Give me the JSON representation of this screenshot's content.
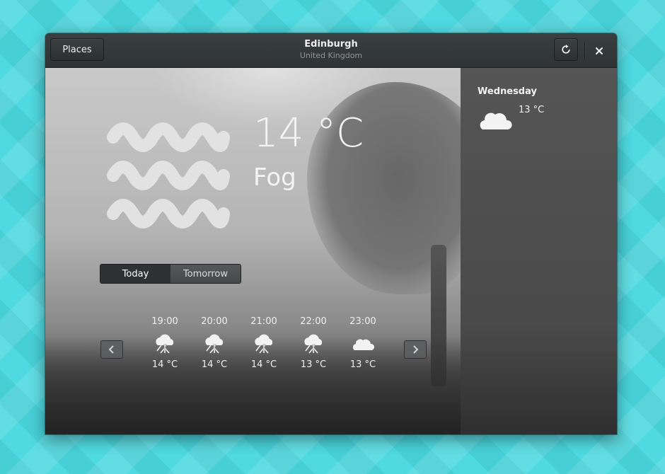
{
  "header": {
    "places_label": "Places",
    "title": "Edinburgh",
    "subtitle": "United Kingdom",
    "refresh_icon": "refresh-icon",
    "close_icon": "close-icon"
  },
  "current": {
    "temperature": "14 °C",
    "summary": "Fog",
    "icon": "fog-icon"
  },
  "switch": {
    "today_label": "Today",
    "tomorrow_label": "Tomorrow",
    "selected": "Today"
  },
  "forecast": {
    "hours": [
      {
        "time": "19:00",
        "icon": "thunderstorm-icon",
        "temp": "14 °C"
      },
      {
        "time": "20:00",
        "icon": "thunderstorm-icon",
        "temp": "14 °C"
      },
      {
        "time": "21:00",
        "icon": "thunderstorm-icon",
        "temp": "14 °C"
      },
      {
        "time": "22:00",
        "icon": "thunderstorm-icon",
        "temp": "13 °C"
      },
      {
        "time": "23:00",
        "icon": "cloud-icon",
        "temp": "13 °C"
      }
    ]
  },
  "sidebar": {
    "day": "Wednesday",
    "icon": "cloud-icon",
    "temp": "13 °C"
  },
  "colors": {
    "desktop_background": "#4fd9e0",
    "headerbar": "#353a3b",
    "sidebar": "#4d4d4d",
    "text": "#eeeeec"
  }
}
